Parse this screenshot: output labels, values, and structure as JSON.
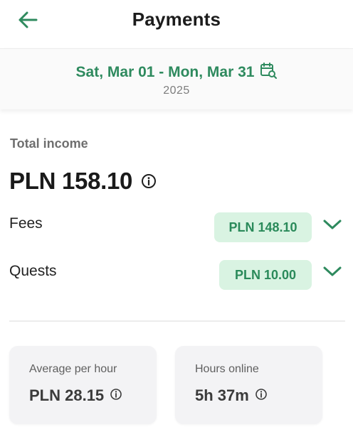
{
  "header": {
    "title": "Payments",
    "back_icon": "arrow-left-icon"
  },
  "date_filter": {
    "range": "Sat, Mar 01 - Mon, Mar 31",
    "year": "2025",
    "icon": "calendar-search-icon"
  },
  "income": {
    "label": "Total income",
    "total": "PLN 158.10",
    "info_icon": "info-icon",
    "rows": [
      {
        "label": "Fees",
        "amount": "PLN 148.10",
        "icon": "chevron-down-icon"
      },
      {
        "label": "Quests",
        "amount": "PLN 10.00",
        "icon": "chevron-down-icon"
      }
    ]
  },
  "stats": [
    {
      "label": "Average per hour",
      "value": "PLN 28.15",
      "icon": "info-icon"
    },
    {
      "label": "Hours online",
      "value": "5h 37m",
      "icon": "info-icon"
    }
  ],
  "colors": {
    "accent": "#2e8a5e",
    "pill_bg": "#d9f3e2",
    "card_bg": "#f3f3f5"
  }
}
